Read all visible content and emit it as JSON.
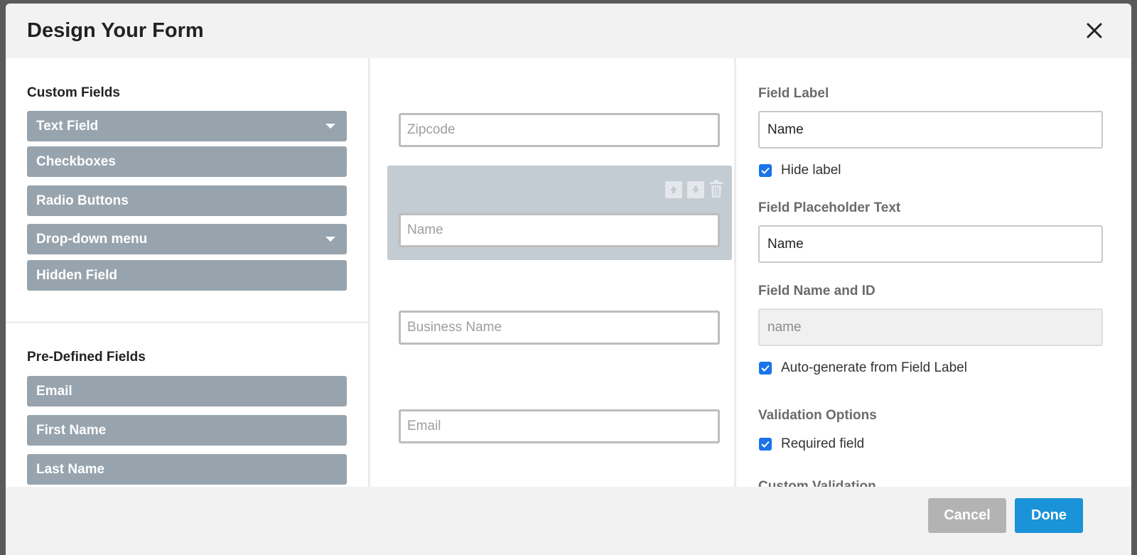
{
  "header": {
    "title": "Design Your Form"
  },
  "left": {
    "custom_title": "Custom Fields",
    "custom_fields": [
      {
        "label": "Text Field",
        "dropdown": true
      },
      {
        "label": "Checkboxes",
        "dropdown": false
      },
      {
        "label": "Radio Buttons",
        "dropdown": false
      },
      {
        "label": "Drop-down menu",
        "dropdown": true
      },
      {
        "label": "Hidden Field",
        "dropdown": false
      }
    ],
    "predefined_title": "Pre-Defined Fields",
    "predefined_fields": [
      {
        "label": "Email"
      },
      {
        "label": "First Name"
      },
      {
        "label": "Last Name"
      }
    ]
  },
  "preview": {
    "fields": [
      {
        "placeholder": "Zipcode"
      },
      {
        "placeholder": "Name"
      },
      {
        "placeholder": "Business Name"
      },
      {
        "placeholder": "Email"
      }
    ]
  },
  "settings": {
    "field_label": "Field Label",
    "field_label_value": "Name",
    "hide_label": "Hide label",
    "hide_label_checked": true,
    "placeholder_label": "Field Placeholder Text",
    "placeholder_value": "Name",
    "name_id_label": "Field Name and ID",
    "name_id_value": "name",
    "auto_generate": "Auto-generate from Field Label",
    "auto_generate_checked": true,
    "validation_label": "Validation Options",
    "required": "Required field",
    "required_checked": true,
    "custom_validation_partial": "Custom Validation"
  },
  "footer": {
    "cancel": "Cancel",
    "done": "Done"
  },
  "colors": {
    "field_button": "#97a4ae",
    "selected_block": "#c3cbd3",
    "checkbox": "#1a73e8",
    "done": "#1a93d8",
    "cancel": "#b3b3b3"
  }
}
